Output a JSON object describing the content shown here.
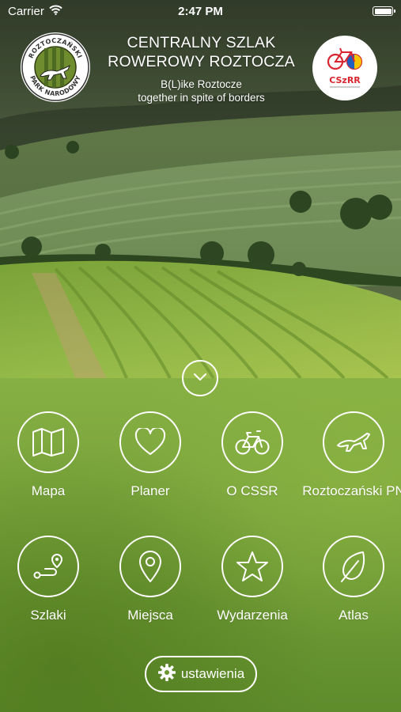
{
  "status_bar": {
    "carrier": "Carrier",
    "time": "2:47 PM",
    "icons": [
      "wifi-icon",
      "battery-icon"
    ]
  },
  "header": {
    "title_line1": "CENTRALNY SZLAK",
    "title_line2": "ROWEROWY ROZTOCZA",
    "subtitle_line1": "B(L)ike Roztocze",
    "subtitle_line2": "together in spite of borders",
    "left_logo": {
      "text_top": "ROZTOCZAŃSKI",
      "text_bottom": "PARK NARODOWY",
      "icon": "horse-logo"
    },
    "right_logo": {
      "text": "CSzRR",
      "icon": "bicycle-logo"
    }
  },
  "menu": {
    "expand_icon": "chevron-down-icon",
    "items": [
      {
        "label": "Mapa",
        "icon": "map-icon"
      },
      {
        "label": "Planer",
        "icon": "heart-icon"
      },
      {
        "label": "O CSSR",
        "icon": "bicycle-icon"
      },
      {
        "label": "Roztoczański PN",
        "icon": "horse-icon"
      },
      {
        "label": "Szlaki",
        "icon": "route-icon"
      },
      {
        "label": "Miejsca",
        "icon": "location-pin-icon"
      },
      {
        "label": "Wydarzenia",
        "icon": "star-icon"
      },
      {
        "label": "Atlas",
        "icon": "leaf-icon"
      }
    ]
  },
  "settings": {
    "label": "ustawienia",
    "icon": "gear-icon"
  },
  "colors": {
    "accent_green": "#76a13a",
    "text": "#ffffff"
  }
}
